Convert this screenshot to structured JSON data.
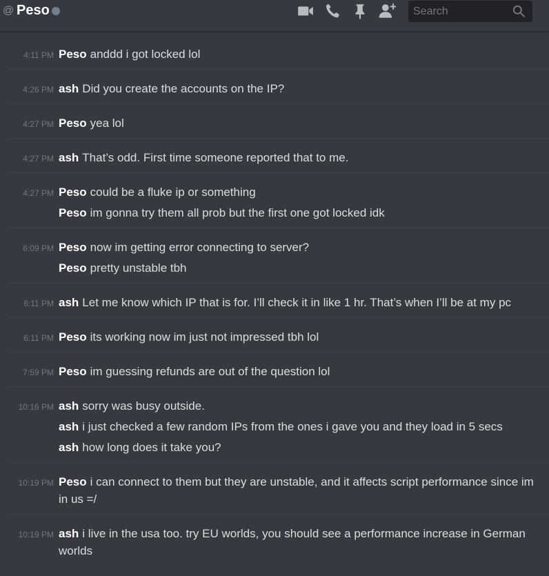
{
  "header": {
    "at_symbol": "@",
    "title": "Peso",
    "search_placeholder": "Search"
  },
  "icons": {
    "video": "video-camera-icon",
    "call": "phone-icon",
    "pin": "pin-icon",
    "add_friend": "add-friend-icon",
    "search": "magnifier-icon"
  },
  "colors": {
    "background": "#36393f",
    "author": "#ffffff",
    "text": "#dcddde",
    "timestamp": "#72767d",
    "status_offline": "#747f8d",
    "search_bg": "#202225"
  },
  "messages": [
    {
      "time": "4:11 PM",
      "lines": [
        {
          "author": "Peso",
          "text": "anddd i got locked lol"
        }
      ]
    },
    {
      "time": "4:26 PM",
      "lines": [
        {
          "author": "ash",
          "text": "Did you create the accounts on the IP?"
        }
      ]
    },
    {
      "time": "4:27 PM",
      "lines": [
        {
          "author": "Peso",
          "text": "yea lol"
        }
      ]
    },
    {
      "time": "4:27 PM",
      "lines": [
        {
          "author": "ash",
          "text": "That’s odd. First time someone reported that to me."
        }
      ]
    },
    {
      "time": "4:27 PM",
      "lines": [
        {
          "author": "Peso",
          "text": "could be a fluke ip or something"
        },
        {
          "author": "Peso",
          "text": "im gonna try them all prob but the first one got locked idk"
        }
      ]
    },
    {
      "time": "6:09 PM",
      "lines": [
        {
          "author": "Peso",
          "text": "now im getting error connecting to server?"
        },
        {
          "author": "Peso",
          "text": "pretty unstable tbh"
        }
      ]
    },
    {
      "time": "6:11 PM",
      "lines": [
        {
          "author": "ash",
          "text": "Let me know which IP that is for. I’ll check it in like 1 hr. That’s when I’ll be at my pc"
        }
      ]
    },
    {
      "time": "6:11 PM",
      "lines": [
        {
          "author": "Peso",
          "text": "its working now im just not impressed tbh lol"
        }
      ]
    },
    {
      "time": "7:59 PM",
      "lines": [
        {
          "author": "Peso",
          "text": "im guessing refunds are out of the question lol"
        }
      ]
    },
    {
      "time": "10:16 PM",
      "lines": [
        {
          "author": "ash",
          "text": "sorry was busy outside."
        },
        {
          "author": "ash",
          "text": "i just checked a few random IPs from the ones i gave you and they load in 5 secs"
        },
        {
          "author": "ash",
          "text": "how long does it take you?"
        }
      ]
    },
    {
      "time": "10:19 PM",
      "lines": [
        {
          "author": "Peso",
          "text": "i can connect to them but they are unstable, and it affects script performance since im in us =/"
        }
      ]
    },
    {
      "time": "10:19 PM",
      "lines": [
        {
          "author": "ash",
          "text": "i live in the usa too. try EU worlds, you should see a performance increase in German worlds"
        }
      ]
    }
  ]
}
